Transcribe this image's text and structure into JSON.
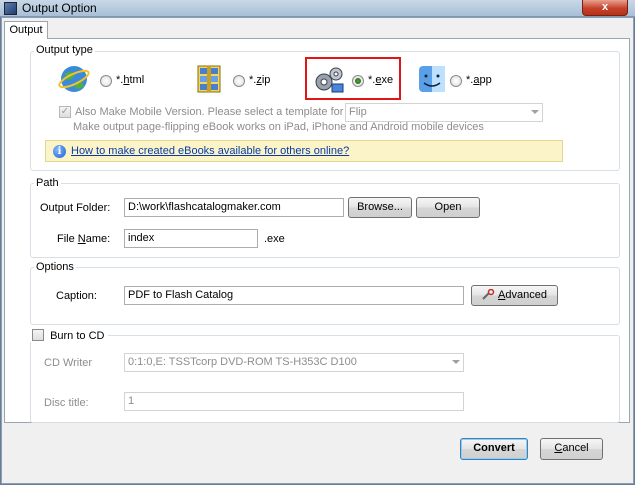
{
  "window": {
    "title": "Output Option",
    "close_label": "x"
  },
  "tab": {
    "label": "Output"
  },
  "output_type": {
    "legend": "Output type",
    "options": [
      {
        "label_prefix": "*.",
        "label_key": "h",
        "label_rest": "tml",
        "icon": "globe-icon",
        "selected": false
      },
      {
        "label_prefix": "*.",
        "label_key": "z",
        "label_rest": "ip",
        "icon": "zip-archive-icon",
        "selected": false
      },
      {
        "label_prefix": "*.",
        "label_key": "e",
        "label_rest": "xe",
        "icon": "gears-icon",
        "selected": true
      },
      {
        "label_prefix": "*.",
        "label_key": "a",
        "label_rest": "pp",
        "icon": "mac-finder-icon",
        "selected": false
      }
    ],
    "mobile_label": "Also Make Mobile Version. Please select a template for mobile:",
    "mobile_checked": true,
    "mobile_template": "Flip",
    "mobile_note": "Make output page-flipping eBook works on iPad, iPhone and Android mobile devices",
    "info_link": "How to make created eBooks available for others online?"
  },
  "path": {
    "legend": "Path",
    "output_folder_label": "Output Folder:",
    "output_folder_value": "D:\\work\\flashcatalogmaker.com",
    "browse_label": "Browse...",
    "open_label": "Open",
    "file_name_label_pre": "File ",
    "file_name_label_key": "N",
    "file_name_label_post": "ame:",
    "file_name_value": "index",
    "file_ext": ".exe"
  },
  "options": {
    "legend": "Options",
    "caption_label": "Caption:",
    "caption_value": "PDF to Flash Catalog",
    "advanced_key": "A",
    "advanced_rest": "dvanced"
  },
  "burn": {
    "label": "Burn to CD",
    "checked": false,
    "cd_writer_label": "CD Writer",
    "cd_writer_value": "0:1:0,E: TSSTcorp DVD-ROM TS-H353C D100",
    "disc_title_label": "Disc title:",
    "disc_title_value": "1"
  },
  "footer": {
    "convert_label": "Convert",
    "cancel_key": "C",
    "cancel_rest": "ancel"
  }
}
